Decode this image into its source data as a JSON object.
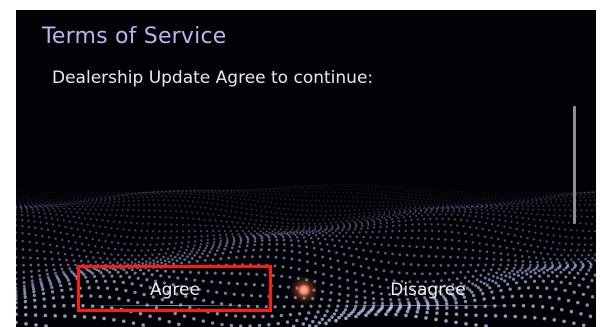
{
  "dialog": {
    "title": "Terms of Service",
    "message": "Dealership Update Agree to continue:"
  },
  "buttons": {
    "agree_label": "Agree",
    "disagree_label": "Disagree"
  },
  "colors": {
    "title": "#b9b4ee",
    "highlight": "#ff1a1a",
    "background": "#020206"
  }
}
